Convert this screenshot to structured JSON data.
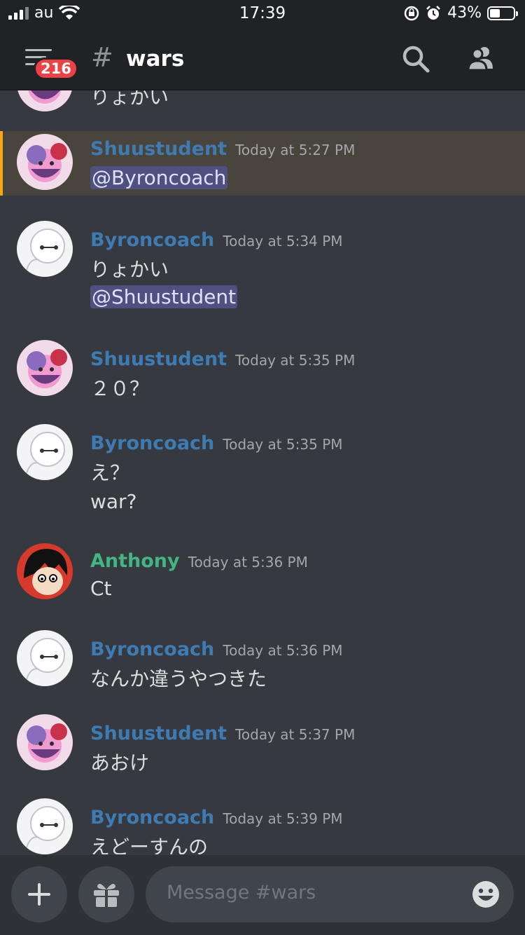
{
  "status_bar": {
    "carrier": "au",
    "time": "17:39",
    "battery": "43%",
    "battery_level": 0.43
  },
  "header": {
    "unread_badge": "216",
    "hash": "#",
    "channel": "wars",
    "search_icon": "search-icon",
    "members_icon": "members-icon"
  },
  "messages": [
    {
      "username": "",
      "timestamp": "",
      "lines": [
        "りょかい"
      ]
    },
    {
      "username": "Shuustudent",
      "timestamp": "Today at 5:27 PM",
      "mention": "@Byroncoach"
    },
    {
      "username": "Byroncoach",
      "timestamp": "Today at 5:34 PM",
      "lines": [
        "りょかい"
      ],
      "mention": "@Shuustudent"
    },
    {
      "username": "Shuustudent",
      "timestamp": "Today at 5:35 PM",
      "lines": [
        "２０？"
      ]
    },
    {
      "username": "Byroncoach",
      "timestamp": "Today at 5:35 PM",
      "lines": [
        "え？",
        "war?"
      ]
    },
    {
      "username": "Anthony",
      "timestamp": "Today at 5:36 PM",
      "lines": [
        "Ct"
      ]
    },
    {
      "username": "Byroncoach",
      "timestamp": "Today at 5:36 PM",
      "lines": [
        "なんか違うやつきた"
      ]
    },
    {
      "username": "Shuustudent",
      "timestamp": "Today at 5:37 PM",
      "lines": [
        "あおけ"
      ]
    },
    {
      "username": "Byroncoach",
      "timestamp": "Today at 5:39 PM",
      "lines": [
        "えどーすんの"
      ]
    }
  ],
  "composer": {
    "placeholder": "Message #wars",
    "add_icon": "plus-icon",
    "gift_icon": "gift-icon",
    "emoji_icon": "emoji-icon"
  },
  "colors": {
    "background": "#36393f",
    "topbar": "#202225",
    "mention_highlight": "#49443c",
    "mention_bar": "#faa61a",
    "username_blue": "#3f7bb3",
    "username_green": "#43b581",
    "badge_red": "#ed4245"
  }
}
